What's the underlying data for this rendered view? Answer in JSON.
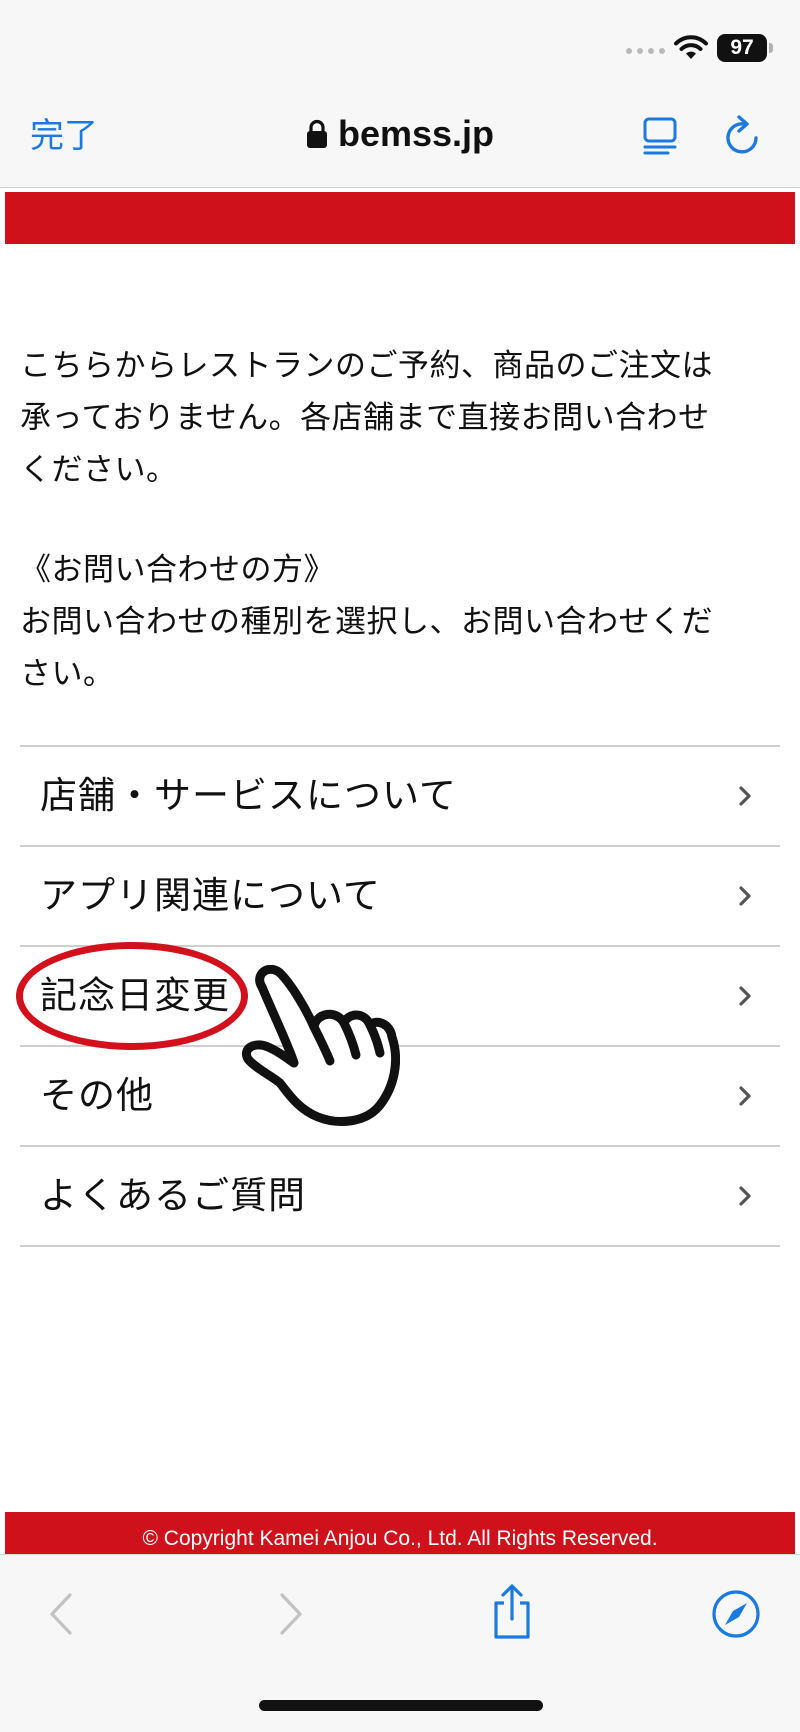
{
  "status_bar": {
    "battery": "97",
    "icons": [
      "signal-dots-icon",
      "wifi-icon",
      "battery-icon"
    ]
  },
  "nav": {
    "done_label": "完了",
    "url": "bemss.jp",
    "icons": [
      "lock-icon",
      "reader-icon",
      "reload-icon"
    ]
  },
  "intro": {
    "line1": "こちらからレストランのご予約、商品のご注文は",
    "line2": "承っておりません。各店舗まで直接お問い合わせ",
    "line3": "ください。"
  },
  "contact": {
    "heading": "《お問い合わせの方》",
    "line1": "お問い合わせの種別を選択し、お問い合わせくだ",
    "line2": "さい。"
  },
  "menu": {
    "items": [
      {
        "label": "店舗・サービスについて"
      },
      {
        "label": "アプリ関連について"
      },
      {
        "label": "記念日変更"
      },
      {
        "label": "その他"
      },
      {
        "label": "よくあるご質問"
      }
    ]
  },
  "annotation": {
    "highlighted_item": "記念日変更",
    "icons": [
      "pointing-hand-icon"
    ]
  },
  "footer": {
    "copyright": "© Copyright Kamei Anjou Co., Ltd. All Rights Reserved."
  },
  "toolbar": {
    "icons": [
      "back-icon",
      "forward-icon",
      "share-icon",
      "compass-icon"
    ]
  },
  "colors": {
    "brand_red": "#cf111b",
    "link_blue": "#1a7ae0",
    "annotation_red": "#d3111d"
  }
}
